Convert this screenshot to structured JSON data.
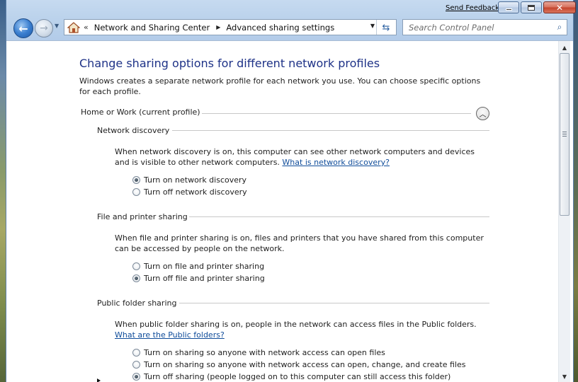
{
  "titlebar": {
    "feedback_link": "Send Feedback"
  },
  "nav": {
    "breadcrumb_overflow": "«",
    "crumbs": [
      "Network and Sharing Center",
      "Advanced sharing settings"
    ],
    "search_placeholder": "Search Control Panel"
  },
  "content": {
    "title": "Change sharing options for different network profiles",
    "intro": "Windows creates a separate network profile for each network you use. You can choose specific options for each profile.",
    "profile_heading": "Home or Work (current profile)",
    "sections": [
      {
        "heading": "Network discovery",
        "description": "When network discovery is on, this computer can see other network computers and devices and is visible to other network computers.",
        "link": "What is network discovery?",
        "options": [
          {
            "label": "Turn on network discovery",
            "checked": true
          },
          {
            "label": "Turn off network discovery",
            "checked": false
          }
        ]
      },
      {
        "heading": "File and printer sharing",
        "description": "When file and printer sharing is on, files and printers that you have shared from this computer can be accessed by people on the network.",
        "link": "",
        "options": [
          {
            "label": "Turn on file and printer sharing",
            "checked": false
          },
          {
            "label": "Turn off file and printer sharing",
            "checked": true
          }
        ]
      },
      {
        "heading": "Public folder sharing",
        "description": "When public folder sharing is on, people in the network can access files in the Public folders.",
        "link": "What are the Public folders?",
        "options": [
          {
            "label": "Turn on sharing so anyone with network access can open files",
            "checked": false
          },
          {
            "label": "Turn on sharing so anyone with network access can open, change, and create files",
            "checked": false
          },
          {
            "label": "Turn off sharing (people logged on to this computer can still access this folder)",
            "checked": true
          }
        ]
      }
    ]
  },
  "colors": {
    "title_blue": "#1e3287",
    "link_blue": "#0f4c9a"
  }
}
